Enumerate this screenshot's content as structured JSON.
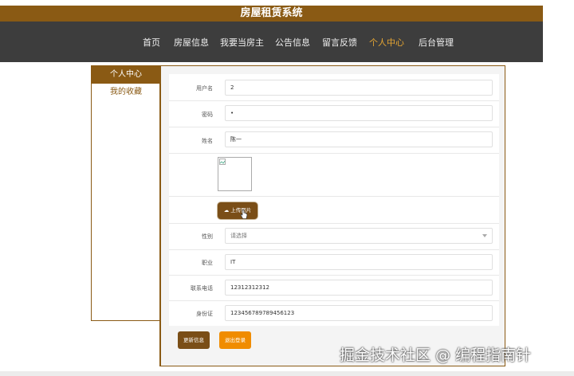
{
  "header": {
    "title": "房屋租赁系统"
  },
  "nav": {
    "items": [
      "首页",
      "房屋信息",
      "我要当房主",
      "公告信息",
      "留言反馈",
      "个人中心",
      "后台管理"
    ],
    "active_index": 5
  },
  "sidebar": {
    "items": [
      "个人中心",
      "我的收藏"
    ],
    "active_index": 0
  },
  "form": {
    "username": {
      "label": "用户名",
      "value": "2"
    },
    "password": {
      "label": "密码",
      "value": "•"
    },
    "name": {
      "label": "姓名",
      "value": "陈一"
    },
    "upload_label": "上传图片",
    "gender": {
      "label": "性别",
      "value": "请选择"
    },
    "job": {
      "label": "职业",
      "value": "IT"
    },
    "phone": {
      "label": "联系电话",
      "value": "12312312312"
    },
    "id_card": {
      "label": "身份证",
      "value": "123456789789456123"
    }
  },
  "buttons": {
    "update": "更新信息",
    "logout": "退出登录"
  },
  "watermark": "掘金技术社区 @ 编程指南针",
  "colors": {
    "brand": "#8a5a14",
    "nav_bg": "#3d3d3d",
    "active_nav": "#e6a633",
    "logout": "#f08c00"
  },
  "icons": {
    "upload": "cloud-upload-icon",
    "cursor": "hand-pointer-icon"
  }
}
